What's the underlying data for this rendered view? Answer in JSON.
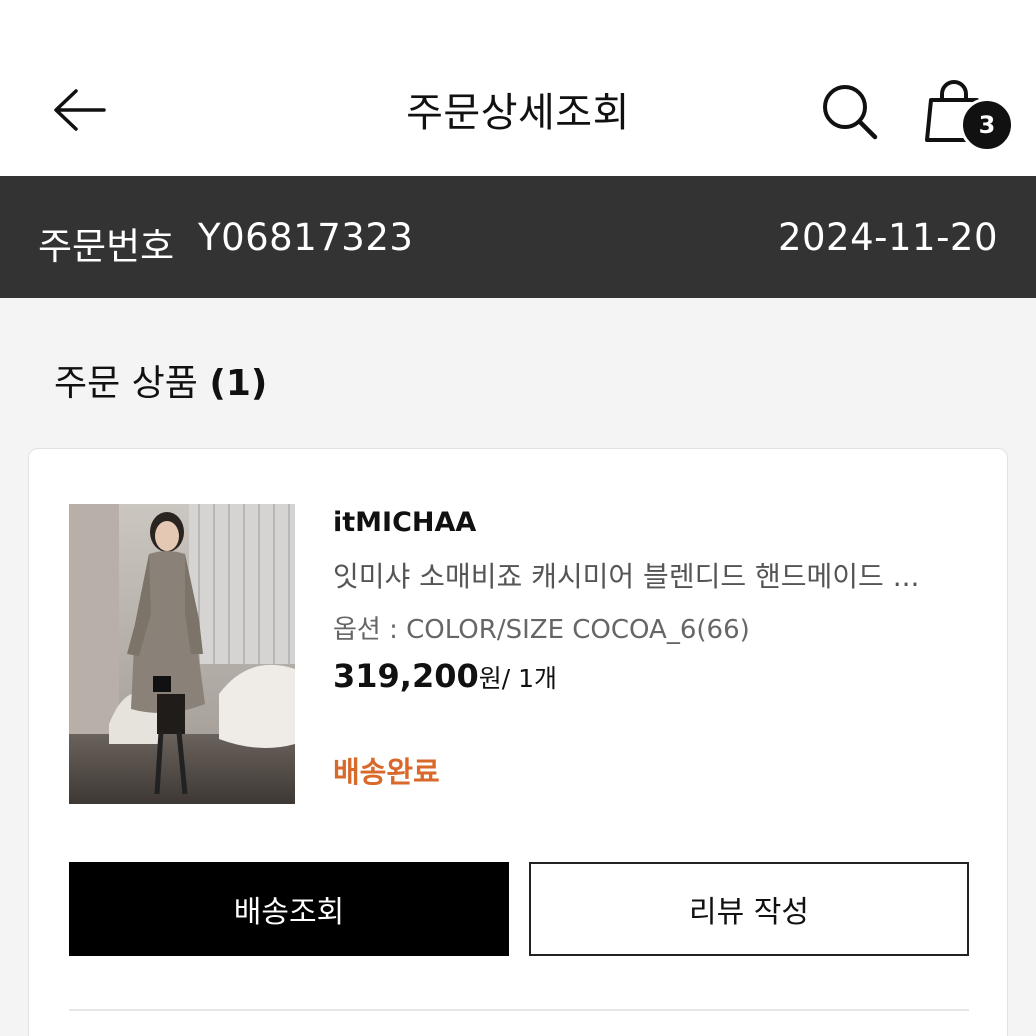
{
  "header": {
    "title": "주문상세조회",
    "cart_count": "3",
    "icons": {
      "back": "back-arrow-icon",
      "search": "search-icon",
      "cart": "shopping-bag-icon"
    }
  },
  "order": {
    "number_label": "주문번호",
    "number": "Y06817323",
    "date": "2024-11-20"
  },
  "section": {
    "title": "주문 상품",
    "count": "(1)"
  },
  "item": {
    "brand": "itMICHAA",
    "name": "잇미샤 소매비죠 캐시미어 블렌디드 핸드메이드 ...",
    "option": "옵션 : COLOR/SIZE COCOA_6(66)",
    "price": "319,200",
    "unit": "원/ 1개",
    "status": "배송완료",
    "status_color": "#d9692a"
  },
  "buttons": {
    "tracking": "배송조회",
    "review": "리뷰 작성"
  },
  "colors": {
    "order_bar": "#333333",
    "primary_button": "#000000",
    "background": "#f4f4f4"
  }
}
